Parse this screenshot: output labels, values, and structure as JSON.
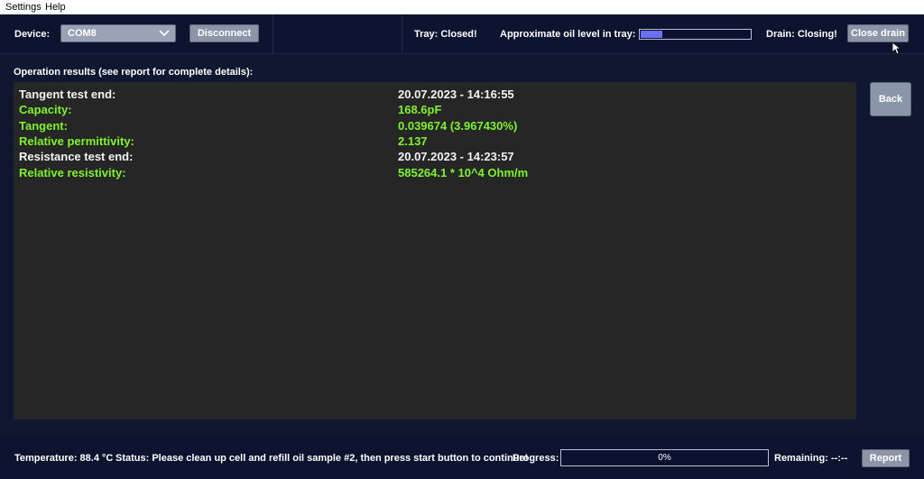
{
  "menu": {
    "settings": "Settings",
    "help": "Help"
  },
  "device": {
    "label": "Device:",
    "selected": "COM8",
    "disconnect": "Disconnect"
  },
  "tray": {
    "status": "Tray: Closed!"
  },
  "oil": {
    "label": "Approximate oil level in tray:",
    "level_fraction": 0.2
  },
  "drain": {
    "status": "Drain: Closing!",
    "button": "Close drain"
  },
  "results": {
    "title": "Operation results (see report for complete details):",
    "rows": [
      {
        "key": "Tangent test end:",
        "value": "20.07.2023 - 14:16:55",
        "color": "white"
      },
      {
        "key": "Capacity:",
        "value": "168.6pF",
        "color": "green"
      },
      {
        "key": "Tangent:",
        "value": "0.039674 (3.967430%)",
        "color": "green"
      },
      {
        "key": "Relative permittivity:",
        "value": "2.137",
        "color": "green"
      },
      {
        "key": "Resistance test end:",
        "value": "20.07.2023 - 14:23:57",
        "color": "white"
      },
      {
        "key": "Relative resistivity:",
        "value": "585264.1 * 10^4 Ohm/m",
        "color": "green"
      }
    ]
  },
  "back": "Back",
  "footer": {
    "temperature": "Temperature: 88.4 °C",
    "status": "Status: Please clean up cell and refill oil sample #2, then press start button to continue!",
    "progress_label": "Progress:",
    "progress_value": "0%",
    "remaining": "Remaining: --:--",
    "report": "Report"
  },
  "colors": {
    "accent_green": "#7ff230",
    "oil_fill": "#6d6ff0",
    "panel_bg": "#262626",
    "app_bg": "#0f1830"
  }
}
